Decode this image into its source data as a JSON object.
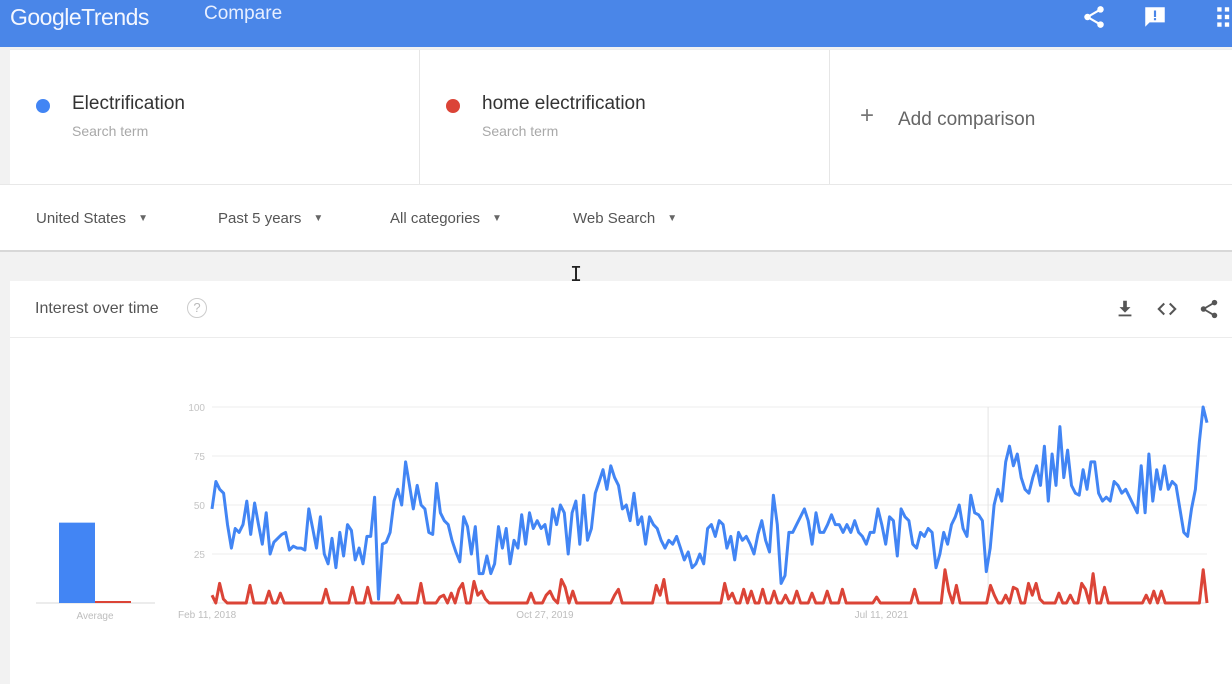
{
  "topbar": {
    "logo_google": "Google",
    "logo_trends": "Trends",
    "page_title": "Compare",
    "icons": [
      "share-icon",
      "feedback-icon",
      "apps-grid-icon"
    ]
  },
  "terms": [
    {
      "name": "Electrification",
      "sub": "Search term",
      "color": "#4285f4"
    },
    {
      "name": "home electrification",
      "sub": "Search term",
      "color": "#db4437"
    }
  ],
  "add_comparison": {
    "icon": "plus-icon",
    "label": "Add comparison"
  },
  "filters": [
    {
      "label": "United States"
    },
    {
      "label": "Past 5 years"
    },
    {
      "label": "All categories"
    },
    {
      "label": "Web Search"
    }
  ],
  "card": {
    "title": "Interest over time",
    "help_glyph": "?",
    "icons": [
      "download-icon",
      "embed-code-icon",
      "share-icon"
    ]
  },
  "chart_data": {
    "type": "line",
    "title": "Interest over time",
    "xlabel": "",
    "ylabel": "",
    "ylim": [
      0,
      100
    ],
    "yticks": [
      25,
      50,
      75,
      100
    ],
    "grid": true,
    "x_tick_labels": [
      {
        "label": "Feb 11, 2018",
        "pos": 0.0
      },
      {
        "label": "Oct 27, 2019",
        "pos": 0.34
      },
      {
        "label": "Jul 11, 2021",
        "pos": 0.68
      }
    ],
    "partial_data_marker_pos": 0.78,
    "average": {
      "label": "Average",
      "values": [
        41,
        1
      ]
    },
    "series": [
      {
        "name": "Electrification",
        "color": "#4285f4",
        "values": [
          48,
          62,
          58,
          56,
          40,
          28,
          38,
          36,
          40,
          52,
          35,
          51,
          40,
          30,
          46,
          25,
          31,
          33,
          35,
          36,
          27,
          29,
          28,
          28,
          27,
          48,
          38,
          28,
          44,
          25,
          20,
          33,
          18,
          36,
          24,
          40,
          37,
          22,
          28,
          20,
          34,
          34,
          54,
          2,
          30,
          31,
          36,
          52,
          58,
          50,
          72,
          60,
          48,
          60,
          50,
          48,
          36,
          35,
          61,
          46,
          42,
          40,
          32,
          26,
          21,
          44,
          39,
          25,
          39,
          15,
          15,
          24,
          15,
          20,
          39,
          28,
          38,
          20,
          32,
          28,
          45,
          30,
          46,
          38,
          42,
          38,
          40,
          30,
          48,
          40,
          50,
          46,
          25,
          46,
          52,
          30,
          55,
          32,
          38,
          56,
          62,
          68,
          58,
          70,
          64,
          60,
          48,
          50,
          42,
          56,
          40,
          44,
          30,
          44,
          40,
          38,
          32,
          28,
          32,
          30,
          34,
          28,
          22,
          26,
          18,
          20,
          25,
          20,
          38,
          40,
          34,
          42,
          40,
          28,
          34,
          22,
          36,
          32,
          34,
          30,
          25,
          35,
          42,
          32,
          26,
          55,
          40,
          10,
          14,
          36,
          36,
          40,
          44,
          48,
          42,
          30,
          46,
          36,
          36,
          40,
          45,
          40,
          40,
          36,
          40,
          36,
          42,
          36,
          34,
          30,
          36,
          36,
          48,
          40,
          30,
          44,
          42,
          24,
          48,
          44,
          42,
          30,
          28,
          36,
          34,
          38,
          36,
          18,
          25,
          36,
          30,
          40,
          44,
          50,
          38,
          34,
          55,
          46,
          45,
          42,
          16,
          28,
          50,
          58,
          52,
          72,
          80,
          70,
          76,
          64,
          58,
          56,
          64,
          70,
          60,
          80,
          52,
          76,
          60,
          90,
          64,
          78,
          60,
          56,
          55,
          68,
          58,
          72,
          72,
          56,
          52,
          54,
          52,
          62,
          60,
          56,
          58,
          54,
          50,
          46,
          70,
          46,
          76,
          52,
          68,
          58,
          70,
          58,
          62,
          60,
          48,
          36,
          34,
          48,
          58,
          82,
          100,
          92
        ]
      },
      {
        "name": "home electrification",
        "color": "#db4437",
        "values": [
          4,
          0,
          10,
          2,
          0,
          0,
          0,
          0,
          0,
          0,
          9,
          0,
          0,
          0,
          0,
          6,
          0,
          0,
          5,
          0,
          0,
          0,
          0,
          0,
          0,
          0,
          0,
          0,
          0,
          0,
          7,
          0,
          0,
          0,
          0,
          0,
          0,
          8,
          0,
          0,
          0,
          8,
          0,
          0,
          0,
          0,
          0,
          0,
          0,
          4,
          0,
          0,
          0,
          0,
          0,
          10,
          0,
          0,
          0,
          0,
          3,
          4,
          0,
          5,
          0,
          7,
          10,
          0,
          0,
          11,
          4,
          6,
          2,
          0,
          0,
          0,
          0,
          0,
          0,
          0,
          0,
          0,
          0,
          0,
          5,
          0,
          0,
          0,
          4,
          6,
          2,
          0,
          12,
          8,
          0,
          6,
          0,
          0,
          0,
          0,
          0,
          0,
          0,
          0,
          0,
          0,
          4,
          7,
          0,
          0,
          0,
          0,
          0,
          0,
          0,
          0,
          0,
          9,
          4,
          12,
          0,
          0,
          0,
          0,
          0,
          0,
          0,
          0,
          0,
          0,
          0,
          0,
          0,
          0,
          0,
          10,
          2,
          5,
          0,
          0,
          7,
          0,
          6,
          0,
          0,
          7,
          0,
          0,
          6,
          0,
          0,
          4,
          0,
          0,
          6,
          0,
          0,
          0,
          5,
          0,
          0,
          0,
          6,
          0,
          0,
          0,
          7,
          0,
          0,
          0,
          0,
          0,
          0,
          0,
          0,
          3,
          0,
          0,
          0,
          0,
          0,
          0,
          0,
          0,
          0,
          7,
          0,
          0,
          0,
          0,
          0,
          0,
          0,
          17,
          6,
          0,
          9,
          0,
          0,
          0,
          0,
          0,
          0,
          0,
          0,
          9,
          4,
          0,
          0,
          4,
          0,
          8,
          7,
          0,
          0,
          10,
          4,
          10,
          2,
          0,
          0,
          0,
          0,
          5,
          0,
          0,
          4,
          0,
          0,
          10,
          7,
          0,
          15,
          0,
          0,
          8,
          0,
          0,
          0,
          0,
          0,
          0,
          0,
          0,
          0,
          0,
          4,
          0,
          6,
          0,
          6,
          0,
          0,
          0,
          0,
          0,
          0,
          0,
          0,
          0,
          0,
          17,
          0
        ]
      }
    ]
  }
}
